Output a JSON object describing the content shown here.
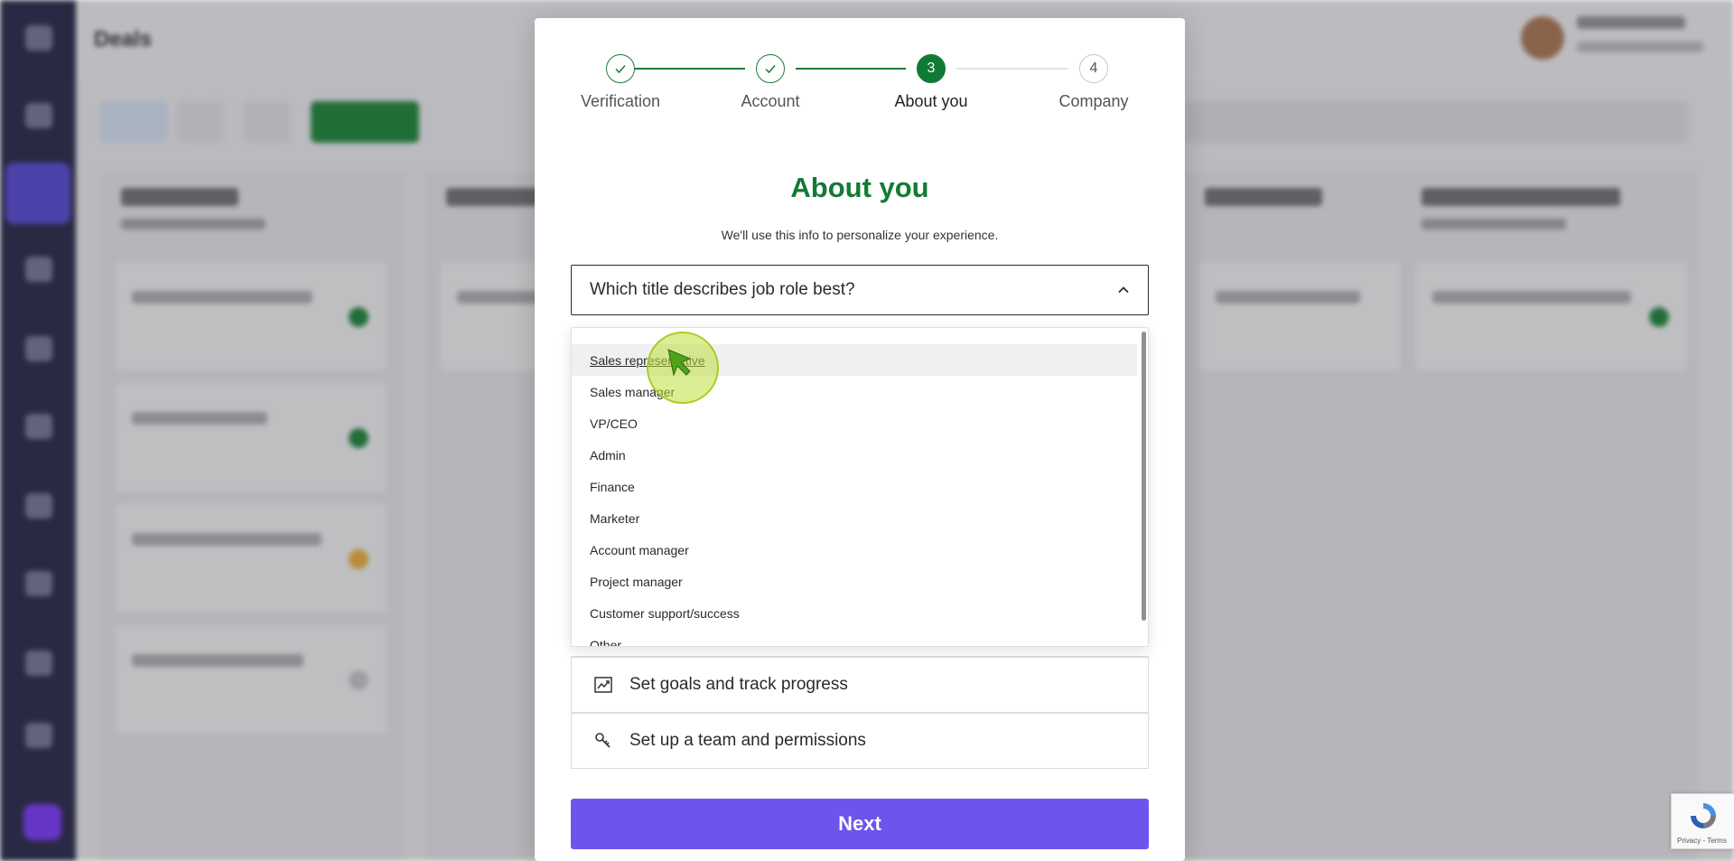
{
  "background": {
    "page_title": "Deals"
  },
  "stepper": {
    "steps": [
      {
        "label": "Verification",
        "state": "done"
      },
      {
        "label": "Account",
        "state": "done"
      },
      {
        "label": "About you",
        "state": "active",
        "number": "3"
      },
      {
        "label": "Company",
        "state": "todo",
        "number": "4"
      }
    ]
  },
  "modal": {
    "title": "About you",
    "subtitle": "We'll use this info to personalize your experience."
  },
  "job_role_select": {
    "placeholder": "Which title describes job role best?",
    "expanded": true,
    "options": [
      "Sales representative",
      "Sales manager",
      "VP/CEO",
      "Admin",
      "Finance",
      "Marketer",
      "Account manager",
      "Project manager",
      "Customer support/success",
      "Other"
    ],
    "hovered_option": "Sales representative"
  },
  "goals": [
    {
      "label": "Set goals and track progress",
      "icon": "chart-trend-icon"
    },
    {
      "label": "Set up a team and permissions",
      "icon": "key-icon"
    }
  ],
  "actions": {
    "next_label": "Next"
  },
  "recaptcha": {
    "footer": "Privacy - Terms"
  },
  "colors": {
    "accent_green": "#137a35",
    "primary_button": "#6c55ec"
  }
}
